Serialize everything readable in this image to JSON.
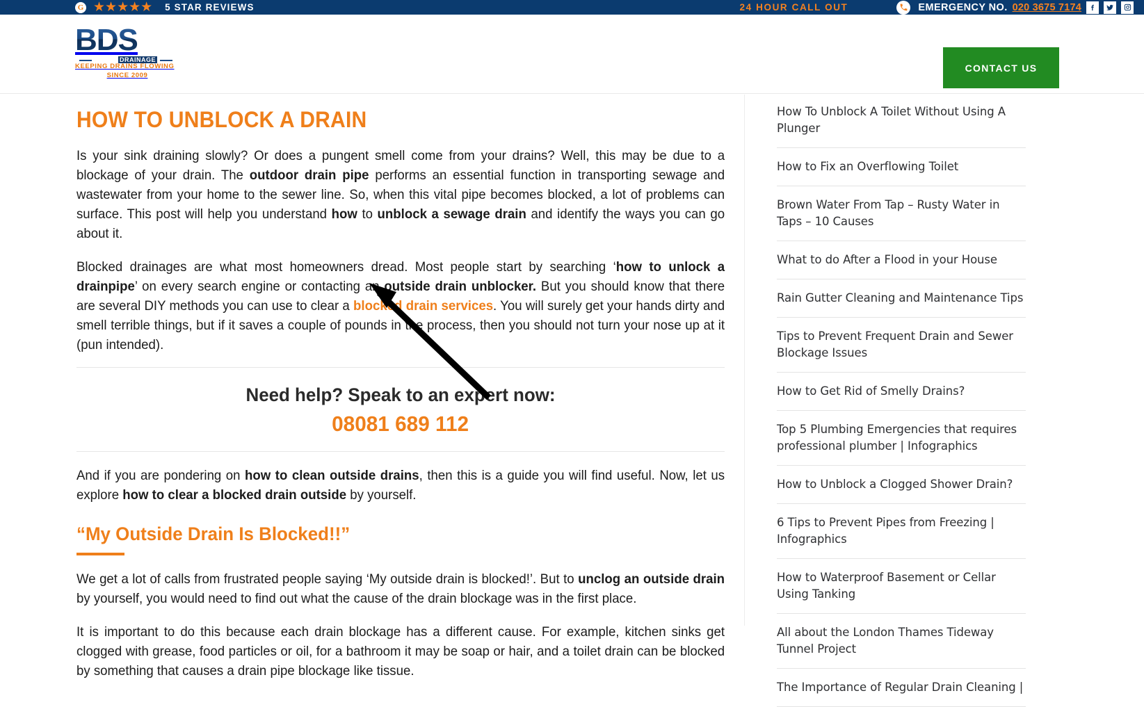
{
  "topbar": {
    "google_badge": "G",
    "stars": "★★★★★",
    "reviews_label": "5 STAR REVIEWS",
    "call_out": "24 HOUR CALL OUT",
    "emergency_label": "EMERGENCY NO.",
    "emergency_number": "020 3675 7174",
    "social": [
      "facebook-icon",
      "twitter-icon",
      "instagram-icon"
    ],
    "bg_color": "#0b3b6f",
    "accent_color": "#f58220"
  },
  "header": {
    "logo_main": "BDS",
    "logo_sub": "DRAINAGE",
    "logo_tagline_line1": "KEEPING DRAINS FLOWING",
    "logo_tagline_line2": "SINCE 2009",
    "contact_button": "CONTACT US",
    "contact_button_color": "#228b22"
  },
  "article": {
    "title": "HOW TO UNBLOCK A DRAIN",
    "title_color": "#ef7f1a",
    "p1": {
      "a": "Is your sink draining slowly? Or does a pungent smell come from your drains? Well, this may be due to a blockage of your drain. The ",
      "b1": "outdoor drain pipe",
      "c": " performs an essential function in transporting sewage and wastewater from your home to the sewer line. So, when this vital pipe becomes blocked, a lot of problems can surface. This post will help you understand ",
      "b2": "how",
      "d": " to ",
      "b3": "unblock a sewage drain",
      "e": " and identify the ways you can go about it."
    },
    "p2": {
      "a": "Blocked drainages are what most homeowners dread. Most people start by searching ‘",
      "b1": "how to unlock a drainpipe",
      "c": "’ on every search engine or contacting an ",
      "b2": "outside drain unblocker.",
      "d": " But you should know that there are several DIY methods you can use to clear a ",
      "link": "blocked drain services",
      "e": ". You will surely get your hands dirty and smell terrible things, but if it saves a couple of pounds in the process, then you should not turn your nose up at it (pun intended)."
    },
    "cta_heading": "Need help? Speak to an expert now:",
    "cta_phone": "08081 689 112",
    "p3": {
      "a": "And if you are pondering on ",
      "b1": "how to clean outside drains",
      "c": ", then this is a guide you will find useful. Now, let us explore ",
      "b2": "how to clear a blocked drain outside",
      "d": " by yourself."
    },
    "subheading": "“My Outside Drain Is Blocked!!”",
    "p4": {
      "a": "We get a lot of calls from frustrated people saying ‘My outside drain is blocked!’. But to ",
      "b1": "unclog an outside drain",
      "c": " by yourself, you would need to find out what the cause of the drain blockage was in the first place."
    },
    "p5": {
      "a": "It is important to do this because each drain blockage has a different cause. For example, kitchen sinks get clogged with grease, food particles or oil, for a bathroom it may be soap or hair, and a toilet drain can be blocked by something that causes a drain pipe blockage like tissue."
    }
  },
  "annotation": {
    "type": "arrow",
    "color": "#000000",
    "points_to": "blocked drain services"
  },
  "sidebar": {
    "items": [
      "How To Unblock A Toilet Without Using A Plunger",
      "How to Fix an Overflowing Toilet",
      "Brown Water From Tap – Rusty Water in Taps – 10 Causes",
      "What to do After a Flood in your House",
      "Rain Gutter Cleaning and Maintenance Tips",
      "Tips to Prevent Frequent Drain and Sewer Blockage Issues",
      "How to Get Rid of Smelly Drains?",
      "Top 5 Plumbing Emergencies that requires professional plumber | Infographics",
      "How to Unblock a Clogged Shower Drain?",
      "6 Tips to Prevent Pipes from Freezing | Infographics",
      "How to Waterproof Basement or Cellar Using Tanking",
      "All about the London Thames Tideway Tunnel Project",
      "The Importance of Regular Drain Cleaning |"
    ]
  }
}
